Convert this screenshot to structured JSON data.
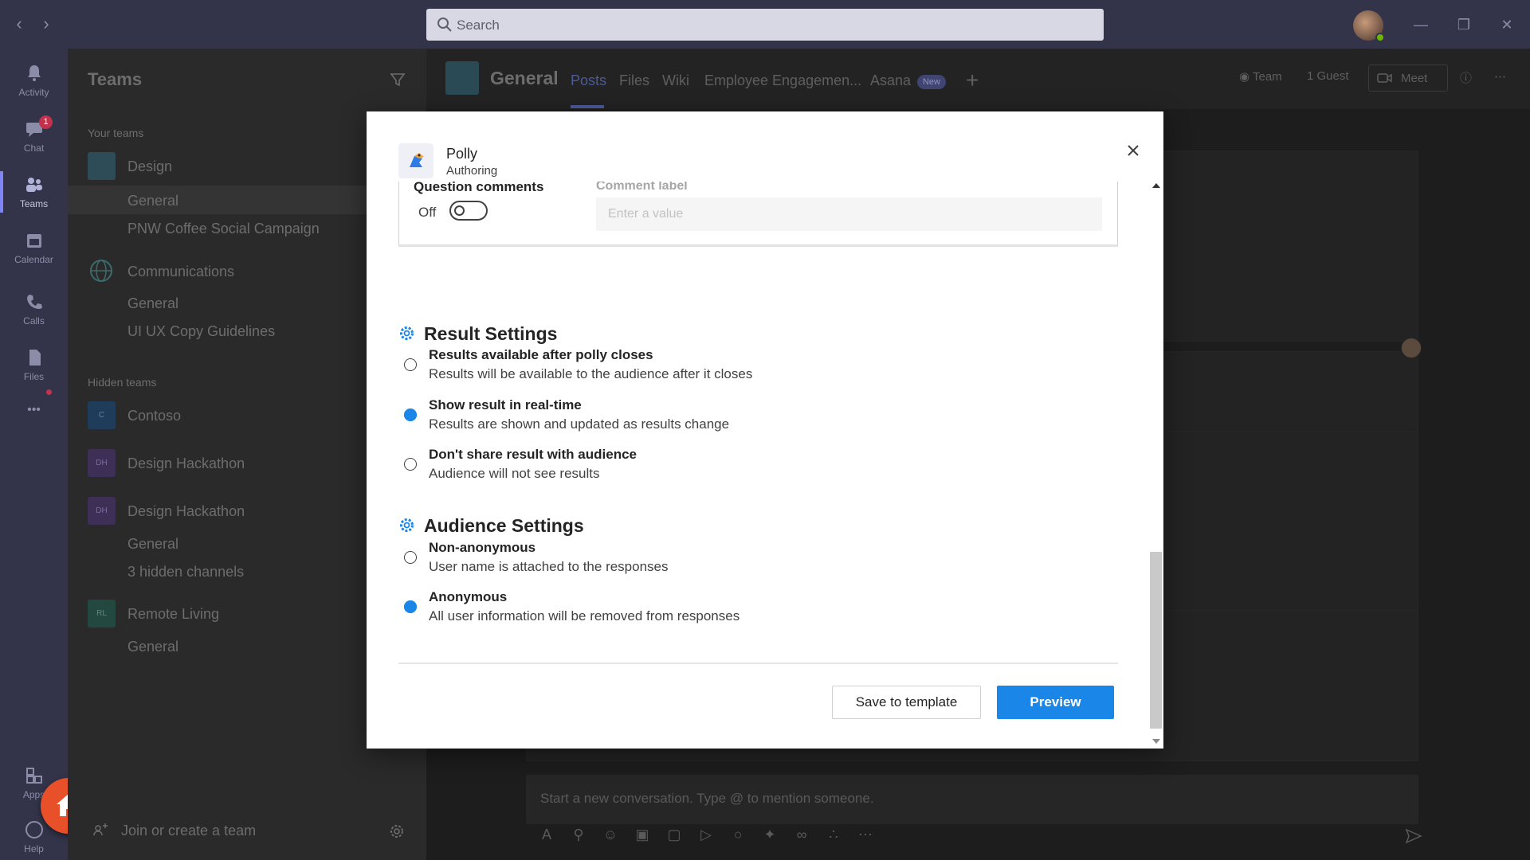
{
  "titlebar": {
    "search_placeholder": "Search",
    "presence_color": "#6bb700"
  },
  "rail": {
    "items": [
      {
        "label": "Activity",
        "icon": "bell-icon"
      },
      {
        "label": "Chat",
        "icon": "chat-icon",
        "badge": "1"
      },
      {
        "label": "Teams",
        "icon": "teams-icon"
      },
      {
        "label": "Calendar",
        "icon": "calendar-icon"
      },
      {
        "label": "Calls",
        "icon": "phone-icon"
      },
      {
        "label": "Files",
        "icon": "file-icon"
      }
    ],
    "more": "•••",
    "apps": "Apps",
    "help": "Help"
  },
  "teams_panel": {
    "title": "Teams",
    "your_teams_label": "Your teams",
    "hidden_teams_label": "Hidden teams",
    "teams": [
      {
        "name": "Design",
        "initials": "",
        "channels": [
          "General",
          "PNW Coffee Social Campaign"
        ]
      },
      {
        "name": "Communications",
        "initials": "",
        "channels": [
          "General",
          "UI UX Copy Guidelines"
        ]
      }
    ],
    "hidden_teams": [
      {
        "name": "Contoso",
        "initials": "C"
      },
      {
        "name": "Design Hackathon",
        "initials": "DH"
      },
      {
        "name": "Design Hackathon",
        "initials": "DH",
        "channels": [
          "General",
          "3 hidden channels"
        ]
      },
      {
        "name": "Remote Living",
        "initials": "RL",
        "channels": [
          "General"
        ]
      }
    ],
    "join_label": "Join or create a team"
  },
  "channel": {
    "name": "General",
    "tabs": [
      "Posts",
      "Files",
      "Wiki",
      "Employee Engagemen...",
      "Asana"
    ],
    "new_badge": "New",
    "team_pill": "Team",
    "guest_pill": "1 Guest",
    "meet_label": "Meet",
    "compose_placeholder": "Start a new conversation. Type @ to mention someone."
  },
  "modal": {
    "app_name": "Polly",
    "app_subtitle": "Authoring",
    "question_comments_label": "Question comments",
    "toggle_state": "Off",
    "comment_label": "Comment label",
    "comment_placeholder": "Enter a value",
    "result_settings": {
      "heading": "Result Settings",
      "options": [
        {
          "title": "Results available after polly closes",
          "desc": "Results will be available to the audience after it closes",
          "selected": false
        },
        {
          "title": "Show result in real-time",
          "desc": "Results are shown and updated as results change",
          "selected": true
        },
        {
          "title": "Don't share result with audience",
          "desc": "Audience will not see results",
          "selected": false
        }
      ]
    },
    "audience_settings": {
      "heading": "Audience Settings",
      "options": [
        {
          "title": "Non-anonymous",
          "desc": "User name is attached to the responses",
          "selected": false
        },
        {
          "title": "Anonymous",
          "desc": "All user information will be removed from responses",
          "selected": true
        }
      ]
    },
    "save_template_label": "Save to template",
    "preview_label": "Preview",
    "accent_color": "#1a86e8"
  }
}
